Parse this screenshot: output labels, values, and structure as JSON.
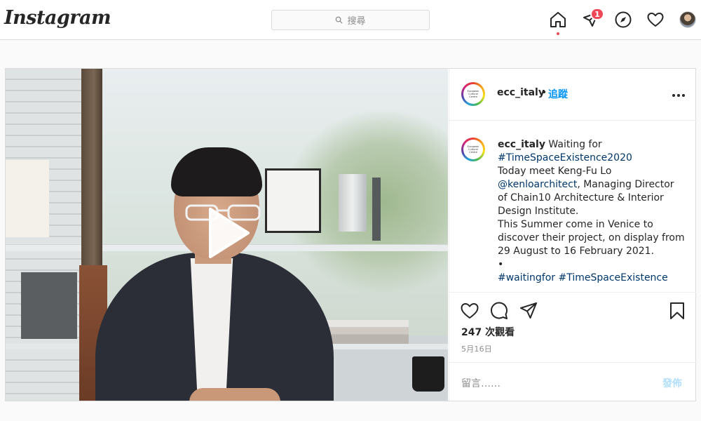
{
  "app": {
    "logo": "Instagram"
  },
  "search": {
    "placeholder": "搜尋",
    "icon": "search-icon"
  },
  "nav": {
    "icons": [
      "home-icon",
      "direct-icon",
      "explore-icon",
      "activity-heart-icon",
      "profile-avatar"
    ],
    "direct_badge": "1",
    "badge_color": "#ed4956"
  },
  "post": {
    "username": "ecc_italy",
    "separator": "•",
    "follow_label": "追蹤",
    "avatar_text": [
      "European",
      "Cultural",
      "Centre"
    ],
    "caption": {
      "username": "ecc_italy",
      "lines": [
        {
          "text": "Waiting for",
          "type": "text",
          "prefix_user": true
        },
        {
          "text": "#TimeSpaceExistence2020",
          "type": "tag"
        },
        {
          "text": "Today meet Keng-Fu Lo",
          "type": "text"
        },
        {
          "text": "@kenloarchitect",
          "type": "tag",
          "suffix": ", Managing Director"
        },
        {
          "text": "of Chain10 Architecture & Interior",
          "type": "text"
        },
        {
          "text": "Design Institute.",
          "type": "text"
        },
        {
          "text": "This Summer come in Venice to",
          "type": "text"
        },
        {
          "text": "discover their project, on display from",
          "type": "text"
        },
        {
          "text": "29 August to 16 February 2021.",
          "type": "text"
        },
        {
          "text": "•",
          "type": "text"
        },
        {
          "text": "#waitingfor #TimeSpaceExistence",
          "type": "tag"
        }
      ]
    },
    "views": "247 次觀看",
    "date": "5月16日",
    "comment_placeholder": "留言……",
    "post_button": "發佈",
    "link_color": "#0095f6",
    "tag_color": "#00376b"
  }
}
